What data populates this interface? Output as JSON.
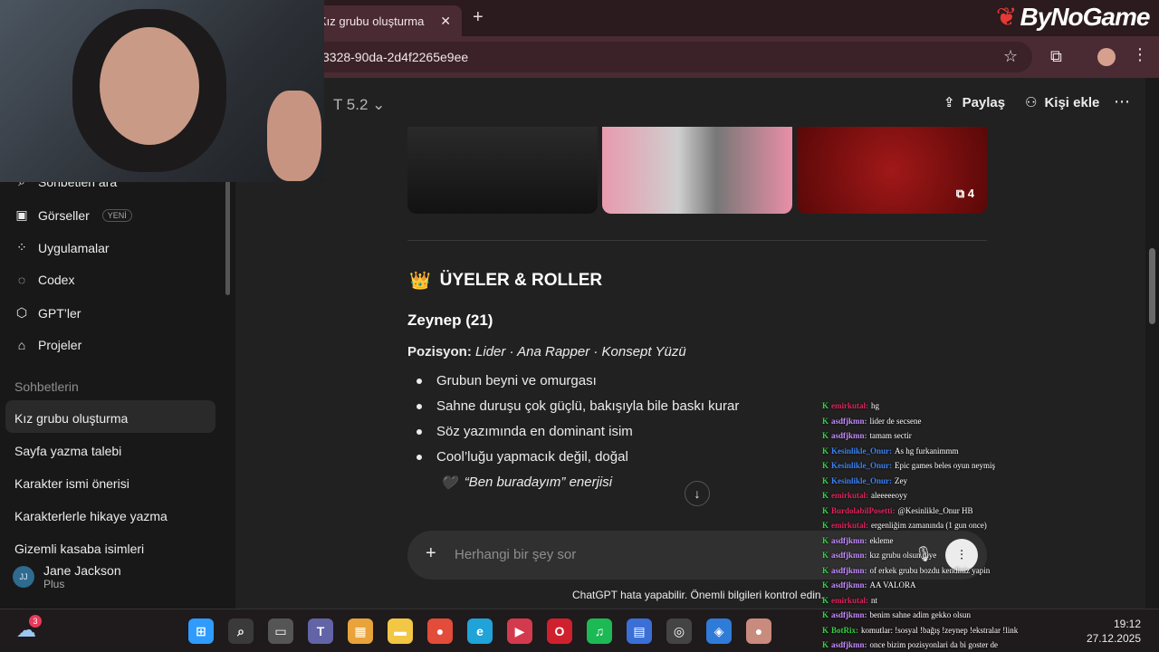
{
  "browser": {
    "tab_title": "Kız grubu oluşturma",
    "url_partial": "3328-90da-2d4f2265e9ee",
    "brand": "ByNoGame"
  },
  "gpt": {
    "model": "T 5.2",
    "share_label": "Paylaş",
    "add_person_label": "Kişi ekle"
  },
  "sidebar": {
    "items": [
      {
        "label": "Sohbetleri ara",
        "icon": "search-icon"
      },
      {
        "label": "Görseller",
        "icon": "images-icon",
        "badge": "YENİ"
      },
      {
        "label": "Uygulamalar",
        "icon": "apps-icon"
      },
      {
        "label": "Codex",
        "icon": "codex-icon"
      },
      {
        "label": "GPT’ler",
        "icon": "cube-icon"
      },
      {
        "label": "Projeler",
        "icon": "folder-icon"
      }
    ],
    "section_label": "Sohbetlerin",
    "chats": [
      "Kız grubu oluşturma",
      "Sayfa yazma talebi",
      "Karakter ismi önerisi",
      "Karakterlerle hikaye yazma",
      "Gizemli kasaba isimleri"
    ],
    "user": {
      "initials": "JJ",
      "name": "Jane Jackson",
      "plan": "Plus"
    }
  },
  "content": {
    "image_count": "4",
    "section_emoji": "👑",
    "section_title": "ÜYELER & ROLLER",
    "member_name": "Zeynep (21)",
    "position_label": "Pozisyon:",
    "position_value": "Lider · Ana Rapper · Konsept Yüzü",
    "bullets": [
      "Grubun beyni ve omurgası",
      "Sahne duruşu çok güçlü, bakışıyla bile baskı kurar",
      "Söz yazımında en dominant isim",
      "Cool’luğu yapmacık değil, doğal"
    ],
    "quote_emoji": "🖤",
    "quote": "“Ben buradayım” enerjisi",
    "composer_placeholder": "Herhangi bir şey sor",
    "disclaimer": "ChatGPT hata yapabilir. Önemli bilgileri kontrol edin."
  },
  "twitch_chat": [
    {
      "user": "emirkutal:",
      "text": "hg",
      "color": "#e0245e"
    },
    {
      "user": "asdfjkmn:",
      "text": "lider de secsene",
      "color": "#c48bff"
    },
    {
      "user": "asdfjkmn:",
      "text": "tamam sectir",
      "color": "#c48bff"
    },
    {
      "user": "Kesinlikle_Onur:",
      "text": "As hg furkanimmm",
      "color": "#3b82f6"
    },
    {
      "user": "Kesinlikle_Onur:",
      "text": "Epic games beles oyun neymiş",
      "color": "#3b82f6"
    },
    {
      "user": "Kesinlikle_Onur:",
      "text": "Zey",
      "color": "#3b82f6"
    },
    {
      "user": "emirkutal:",
      "text": "aleeeeeoyy",
      "color": "#e0245e"
    },
    {
      "user": "BurdolabilPosetti:",
      "text": "@Kesinlikle_Onur HB",
      "color": "#e0245e"
    },
    {
      "user": "emirkutal:",
      "text": "ergenliğim zamanında (1 gun once)",
      "color": "#e0245e"
    },
    {
      "user": "asdfjkmn:",
      "text": "ekleme",
      "color": "#c48bff"
    },
    {
      "user": "asdfjkmn:",
      "text": "kız grubu olsun diye",
      "color": "#c48bff"
    },
    {
      "user": "asdfjkmn:",
      "text": "of erkek grubu bozdu kendiniz yapin",
      "color": "#c48bff"
    },
    {
      "user": "asdfjkmn:",
      "text": "AA VALORA",
      "color": "#c48bff"
    },
    {
      "user": "emirkutal:",
      "text": "nt",
      "color": "#e0245e"
    },
    {
      "user": "asdfjkmn:",
      "text": "benim sahne adim gekko olsun",
      "color": "#c48bff"
    },
    {
      "user": "BotRix:",
      "text": "komutlar: !sosyal !bağış !zeynep !ekstralar !link",
      "color": "#35d14a"
    },
    {
      "user": "asdfjkmn:",
      "text": "once bizim pozisyonlari da bi goster de",
      "color": "#c48bff"
    }
  ],
  "taskbar": {
    "weather_badge": "3",
    "time": "19:12",
    "date": "27.12.2025",
    "apps": [
      "windows-icon",
      "search-icon",
      "taskview-icon",
      "teams-icon",
      "store-icon",
      "explorer-icon",
      "chrome-icon",
      "edge-icon",
      "player-icon",
      "opera-icon",
      "spotify-icon",
      "docs-icon",
      "obs-icon",
      "app-icon",
      "chrome-profile-icon"
    ]
  }
}
